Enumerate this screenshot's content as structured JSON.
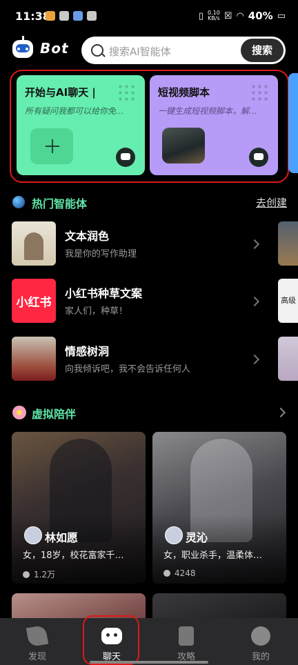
{
  "status_bar": {
    "time": "11:38",
    "net_rate_value": "0.10",
    "net_rate_unit": "KB/s",
    "battery": "40%"
  },
  "header": {
    "app_name": "Bot",
    "search_placeholder": "搜索AI智能体",
    "search_button": "搜索"
  },
  "quick_cards": [
    {
      "title": "开始与AI聊天 |",
      "subtitle": "所有疑问我都可以给你免…",
      "color": "#66eeb0"
    },
    {
      "title": "短视频脚本",
      "subtitle": "一键生成短视频脚本，解…",
      "color": "#b79cf7"
    }
  ],
  "hot_agents": {
    "title": "热门智能体",
    "link": "去创建",
    "items": [
      {
        "name": "文本润色",
        "desc": "我是你的写作助理"
      },
      {
        "name": "小红书种草文案",
        "desc": "家人们，种草！",
        "thumb_text": "小红书"
      },
      {
        "name": "情感树洞",
        "desc": "向我倾诉吧，我不会告诉任何人"
      }
    ],
    "peek_text": "高级"
  },
  "companions": {
    "title": "虚拟陪伴",
    "items": [
      {
        "name": "林如愿",
        "desc": "女，18岁，校花富家千…",
        "likes": "1.2万"
      },
      {
        "name": "灵沁",
        "desc": "女，职业杀手，温柔体…",
        "likes": "4248"
      }
    ]
  },
  "tabbar": {
    "active": "聊天",
    "items": [
      {
        "label": "发现",
        "icon": "leaf-icon"
      },
      {
        "label": "聊天",
        "icon": "robot-chat-icon"
      },
      {
        "label": "攻略",
        "icon": "book-star-icon"
      },
      {
        "label": "我的",
        "icon": "face-icon"
      }
    ]
  }
}
